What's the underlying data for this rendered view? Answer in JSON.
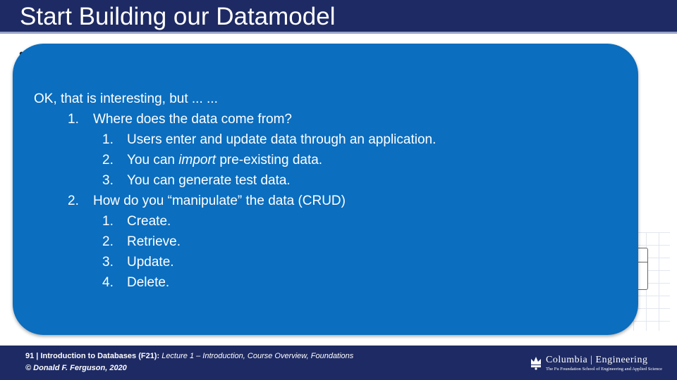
{
  "slide": {
    "title": "Start Building our Datamodel",
    "bullet": "•"
  },
  "callout": {
    "heading": "OK, that is interesting, but ... ...",
    "items": [
      {
        "number": "1.",
        "text": "Where does the data come from?",
        "subitems": [
          {
            "number": "1.",
            "text_before": "Users enter and update data through an application.",
            "emphasis": "",
            "text_after": ""
          },
          {
            "number": "2.",
            "text_before": "You can ",
            "emphasis": "import",
            "text_after": " pre-existing data."
          },
          {
            "number": "3.",
            "text_before": "You can generate test data.",
            "emphasis": "",
            "text_after": ""
          }
        ]
      },
      {
        "number": "2.",
        "text": "How do you “manipulate” the data (CRUD)",
        "subitems": [
          {
            "number": "1.",
            "text_before": "Create.",
            "emphasis": "",
            "text_after": ""
          },
          {
            "number": "2.",
            "text_before": "Retrieve.",
            "emphasis": "",
            "text_after": ""
          },
          {
            "number": "3.",
            "text_before": "Update.",
            "emphasis": "",
            "text_after": ""
          },
          {
            "number": "4.",
            "text_before": "Delete.",
            "emphasis": "",
            "text_after": ""
          }
        ]
      }
    ]
  },
  "footer": {
    "page_number": "91",
    "separator": " | ",
    "course": "Introduction to Databases (F21):",
    "lecture": " Lecture 1 – Introduction, Course Overview, Foundations",
    "copyright": "© Donald F. Ferguson, 2020",
    "logo_name": "Columbia | Engineering",
    "logo_subtitle": "The Fu Foundation School of Engineering and Applied Science"
  },
  "colors": {
    "title_bar": "#1e2a63",
    "callout_fill": "#0b6ebf",
    "footer_bar": "#1e2a63"
  }
}
